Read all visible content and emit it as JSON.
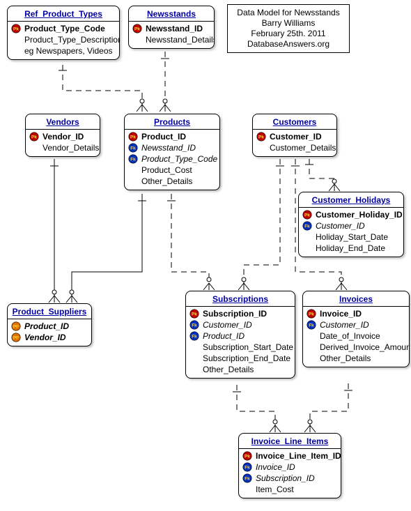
{
  "annotation": {
    "line1": "Data Model for Newsstands",
    "line2": "Barry Williams",
    "line3": "February 25th. 2011",
    "line4": "DatabaseAnswers.org"
  },
  "entities": {
    "ref_product_types": {
      "title": "Ref_Product_Types",
      "attrs": [
        {
          "key": "pk",
          "name": "Product_Type_Code"
        },
        {
          "key": "",
          "name": "Product_Type_Description"
        },
        {
          "key": "",
          "name": "eg Newspapers, Videos"
        }
      ]
    },
    "newsstands": {
      "title": "Newsstands",
      "attrs": [
        {
          "key": "pk",
          "name": "Newsstand_ID"
        },
        {
          "key": "",
          "name": "Newsstand_Details"
        }
      ]
    },
    "vendors": {
      "title": "Vendors",
      "attrs": [
        {
          "key": "pk",
          "name": "Vendor_ID"
        },
        {
          "key": "",
          "name": "Vendor_Details"
        }
      ]
    },
    "products": {
      "title": "Products",
      "attrs": [
        {
          "key": "pk",
          "name": "Product_ID"
        },
        {
          "key": "fk",
          "name": "Newsstand_ID"
        },
        {
          "key": "fk",
          "name": "Product_Type_Code"
        },
        {
          "key": "",
          "name": "Product_Cost"
        },
        {
          "key": "",
          "name": "Other_Details"
        }
      ]
    },
    "customers": {
      "title": "Customers",
      "attrs": [
        {
          "key": "pk",
          "name": "Customer_ID"
        },
        {
          "key": "",
          "name": "Customer_Details"
        }
      ]
    },
    "customer_holidays": {
      "title": "Customer_Holidays",
      "attrs": [
        {
          "key": "pk",
          "name": "Customer_Holiday_ID"
        },
        {
          "key": "fk",
          "name": "Customer_ID"
        },
        {
          "key": "",
          "name": "Holiday_Start_Date"
        },
        {
          "key": "",
          "name": "Holiday_End_Date"
        }
      ]
    },
    "product_suppliers": {
      "title": "Product_Suppliers",
      "attrs": [
        {
          "key": "pf",
          "name": "Product_ID"
        },
        {
          "key": "pf",
          "name": "Vendor_ID"
        }
      ]
    },
    "subscriptions": {
      "title": "Subscriptions",
      "attrs": [
        {
          "key": "pk",
          "name": "Subscription_ID"
        },
        {
          "key": "fk",
          "name": "Customer_ID"
        },
        {
          "key": "fk",
          "name": "Product_ID"
        },
        {
          "key": "",
          "name": "Subscription_Start_Date"
        },
        {
          "key": "",
          "name": "Subscription_End_Date"
        },
        {
          "key": "",
          "name": "Other_Details"
        }
      ]
    },
    "invoices": {
      "title": "Invoices",
      "attrs": [
        {
          "key": "pk",
          "name": "Invoice_ID"
        },
        {
          "key": "fk",
          "name": "Customer_ID"
        },
        {
          "key": "",
          "name": "Date_of_Invoice"
        },
        {
          "key": "",
          "name": "Derived_Invoice_Amount"
        },
        {
          "key": "",
          "name": "Other_Details"
        }
      ]
    },
    "invoice_line_items": {
      "title": "Invoice_Line_Items",
      "attrs": [
        {
          "key": "pk",
          "name": "Invoice_Line_Item_ID"
        },
        {
          "key": "fk",
          "name": "Invoice_ID"
        },
        {
          "key": "fk",
          "name": "Subscription_ID"
        },
        {
          "key": "",
          "name": "Item_Cost"
        }
      ]
    }
  },
  "relationships": [
    {
      "from": "ref_product_types",
      "to": "products",
      "identifying": false,
      "cardinality": "one-to-many-optional"
    },
    {
      "from": "newsstands",
      "to": "products",
      "identifying": false,
      "cardinality": "one-to-many-optional"
    },
    {
      "from": "vendors",
      "to": "product_suppliers",
      "identifying": true,
      "cardinality": "one-to-many-optional"
    },
    {
      "from": "products",
      "to": "product_suppliers",
      "identifying": true,
      "cardinality": "one-to-many-optional"
    },
    {
      "from": "products",
      "to": "subscriptions",
      "identifying": false,
      "cardinality": "one-to-many-optional"
    },
    {
      "from": "customers",
      "to": "customer_holidays",
      "identifying": false,
      "cardinality": "one-to-many-optional"
    },
    {
      "from": "customers",
      "to": "subscriptions",
      "identifying": false,
      "cardinality": "one-to-many-optional"
    },
    {
      "from": "customers",
      "to": "invoices",
      "identifying": false,
      "cardinality": "one-to-many-optional"
    },
    {
      "from": "subscriptions",
      "to": "invoice_line_items",
      "identifying": false,
      "cardinality": "one-to-many-optional"
    },
    {
      "from": "invoices",
      "to": "invoice_line_items",
      "identifying": false,
      "cardinality": "one-to-many-optional"
    }
  ]
}
